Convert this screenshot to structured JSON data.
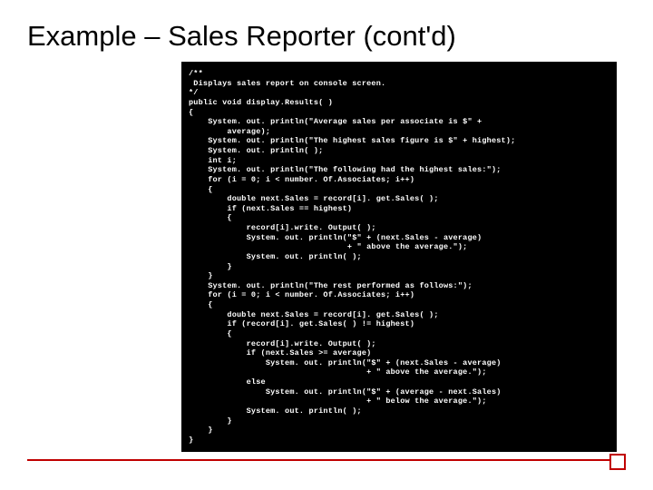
{
  "title": "Example – Sales Reporter (cont'd)",
  "code": "/**\n Displays sales report on console screen.\n*/\npublic void display.Results( )\n{\n    System. out. println(\"Average sales per associate is $\" +\n        average);\n    System. out. println(\"The highest sales figure is $\" + highest);\n    System. out. println( );\n    int i;\n    System. out. println(\"The following had the highest sales:\");\n    for (i = 0; i < number. Of.Associates; i++)\n    {\n        double next.Sales = record[i]. get.Sales( );\n        if (next.Sales == highest)\n        {\n            record[i].write. Output( );\n            System. out. println(\"$\" + (next.Sales - average)\n                                 + \" above the average.\");\n            System. out. println( );\n        }\n    }\n    System. out. println(\"The rest performed as follows:\");\n    for (i = 0; i < number. Of.Associates; i++)\n    {\n        double next.Sales = record[i]. get.Sales( );\n        if (record[i]. get.Sales( ) != highest)\n        {\n            record[i].write. Output( );\n            if (next.Sales >= average)\n                System. out. println(\"$\" + (next.Sales - average)\n                                     + \" above the average.\");\n            else\n                System. out. println(\"$\" + (average - next.Sales)\n                                     + \" below the average.\");\n            System. out. println( );\n        }\n    }\n}"
}
